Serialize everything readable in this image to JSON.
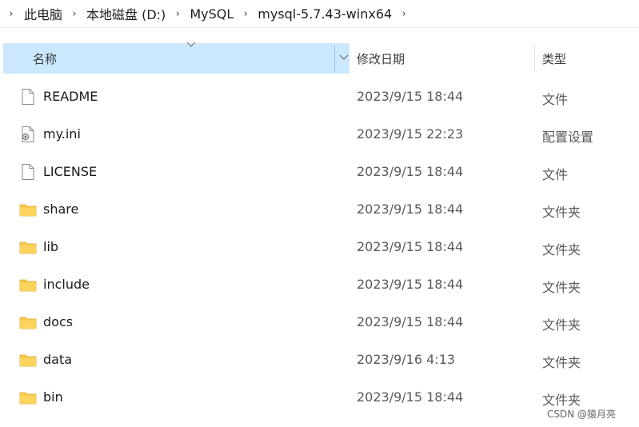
{
  "breadcrumb": {
    "items": [
      "此电脑",
      "本地磁盘 (D:)",
      "MySQL",
      "mysql-5.7.43-winx64"
    ]
  },
  "columns": {
    "name": "名称",
    "date": "修改日期",
    "type": "类型"
  },
  "rows": [
    {
      "name": "README",
      "date": "2023/9/15 18:44",
      "type": "文件",
      "icon": "file-icon"
    },
    {
      "name": "my.ini",
      "date": "2023/9/15 22:23",
      "type": "配置设置",
      "icon": "settings-file-icon"
    },
    {
      "name": "LICENSE",
      "date": "2023/9/15 18:44",
      "type": "文件",
      "icon": "file-icon"
    },
    {
      "name": "share",
      "date": "2023/9/15 18:44",
      "type": "文件夹",
      "icon": "folder-icon"
    },
    {
      "name": "lib",
      "date": "2023/9/15 18:44",
      "type": "文件夹",
      "icon": "folder-icon"
    },
    {
      "name": "include",
      "date": "2023/9/15 18:44",
      "type": "文件夹",
      "icon": "folder-icon"
    },
    {
      "name": "docs",
      "date": "2023/9/15 18:44",
      "type": "文件夹",
      "icon": "folder-icon"
    },
    {
      "name": "data",
      "date": "2023/9/16 4:13",
      "type": "文件夹",
      "icon": "folder-icon"
    },
    {
      "name": "bin",
      "date": "2023/9/15 18:44",
      "type": "文件夹",
      "icon": "folder-icon"
    }
  ],
  "watermark": "CSDN @猿月亮",
  "colors": {
    "header_selected": "#cce8ff",
    "folder": "#f8c94b"
  }
}
